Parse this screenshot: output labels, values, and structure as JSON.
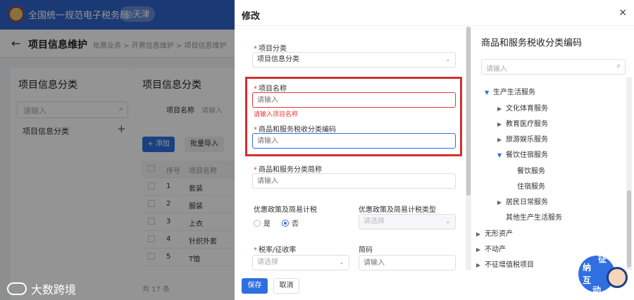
{
  "app": {
    "title": "全国统一规范电子税务局",
    "region": "◎天津"
  },
  "page": {
    "title": "项目信息维护",
    "breadcrumb": "批票业务 > 开票信息维护 > 项目信息维护"
  },
  "left_panel": {
    "title": "项目信息分类",
    "search_placeholder": "请输入",
    "item": "项目信息分类",
    "add_icon": "plus-icon"
  },
  "main_panel": {
    "title": "项目信息分类",
    "filter_label": "项目名称",
    "filter_placeholder": "请输入",
    "add_button": "+ 添加",
    "import_button": "批量导入",
    "table_headers": [
      "序号",
      "项目名称"
    ],
    "rows": [
      {
        "no": "1",
        "name": "套装"
      },
      {
        "no": "2",
        "name": "服装"
      },
      {
        "no": "3",
        "name": "上衣"
      },
      {
        "no": "4",
        "name": "针织外套"
      },
      {
        "no": "5",
        "name": "T恤"
      }
    ],
    "total": "共 17 条"
  },
  "watermark": "大数跨境",
  "dialog": {
    "title": "修改",
    "close": "×",
    "fields": {
      "category": {
        "label": "项目分类",
        "value": "项目信息分类"
      },
      "name": {
        "label": "项目名称",
        "placeholder": "请输入",
        "error": "请输入项目名称"
      },
      "tax_code": {
        "label": "商品和服务税收分类编码",
        "placeholder": "请输入"
      },
      "tax_short": {
        "label": "商品和服务分类简称",
        "placeholder": "请输入"
      },
      "policy": {
        "label": "优惠政策及简易计税",
        "options": [
          "是",
          "否"
        ],
        "selected": "否"
      },
      "policy_type": {
        "label": "优惠政策及简易计税类型",
        "placeholder": "请选择"
      },
      "tax_rate": {
        "label": "税率/征收率",
        "placeholder": "请选择"
      },
      "short_code": {
        "label": "简码",
        "placeholder": "请输入"
      }
    },
    "save": "保存",
    "cancel": "取消"
  },
  "tree": {
    "title": "商品和服务税收分类编码",
    "search_placeholder": "请输入",
    "nodes": [
      {
        "label": "生产生活服务",
        "level": 1,
        "state": "open"
      },
      {
        "label": "文化体育服务",
        "level": 2,
        "state": "closed"
      },
      {
        "label": "教育医疗服务",
        "level": 2,
        "state": "closed"
      },
      {
        "label": "旅游娱乐服务",
        "level": 2,
        "state": "closed"
      },
      {
        "label": "餐饮住宿服务",
        "level": 2,
        "state": "open"
      },
      {
        "label": "餐饮服务",
        "level": 3,
        "state": "leaf"
      },
      {
        "label": "住宿服务",
        "level": 3,
        "state": "leaf"
      },
      {
        "label": "居民日常服务",
        "level": 2,
        "state": "closed"
      },
      {
        "label": "其他生产生活服务",
        "level": 2,
        "state": "leaf"
      },
      {
        "label": "无形资产",
        "level": 0,
        "state": "closed"
      },
      {
        "label": "不动产",
        "level": 0,
        "state": "closed"
      },
      {
        "label": "不征增值税项目",
        "level": 0,
        "state": "closed"
      }
    ]
  },
  "mascot": {
    "text": [
      "征",
      "纳",
      "互",
      "动"
    ]
  },
  "colors": {
    "primary": "#2f6fe0",
    "error": "#e53935",
    "highlight_box": "#d32f2f"
  }
}
